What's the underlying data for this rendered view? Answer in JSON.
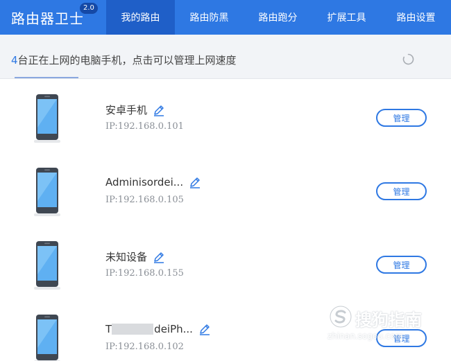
{
  "header": {
    "brand_title": "路由器卫士",
    "brand_version": "2.0",
    "tabs": [
      {
        "label": "我的路由",
        "active": true
      },
      {
        "label": "路由防黑",
        "active": false
      },
      {
        "label": "路由跑分",
        "active": false
      },
      {
        "label": "扩展工具",
        "active": false
      },
      {
        "label": "路由设置",
        "active": false
      }
    ]
  },
  "status": {
    "count": "4",
    "message": "台正在上网的电脑手机，点击可以管理上网速度",
    "refresh_icon": "refresh-spinner-icon"
  },
  "devices": [
    {
      "name": "安卓手机",
      "ip": "IP:192.168.0.101",
      "manage_label": "管理",
      "icon": "smartphone-icon"
    },
    {
      "name": "Adminisordei...",
      "ip": "IP:192.168.0.105",
      "manage_label": "管理",
      "icon": "smartphone-icon"
    },
    {
      "name": "未知设备",
      "ip": "IP:192.168.0.155",
      "manage_label": "管理",
      "icon": "smartphone-icon"
    },
    {
      "name_prefix": "T",
      "name": "deiPh...",
      "name_redacted": true,
      "ip": "IP:192.168.0.102",
      "manage_label": "管理",
      "icon": "smartphone-icon"
    }
  ],
  "watermark": {
    "main": "搜狗指南",
    "sub": "zhinan.sogou.com"
  },
  "colors": {
    "header_bg": "#2e78e3",
    "active_tab_bg": "#1f5fc8",
    "accent": "#2e78e3",
    "status_bg": "#f2f4f7",
    "text_primary": "#333333",
    "text_secondary": "#8a8f96"
  }
}
